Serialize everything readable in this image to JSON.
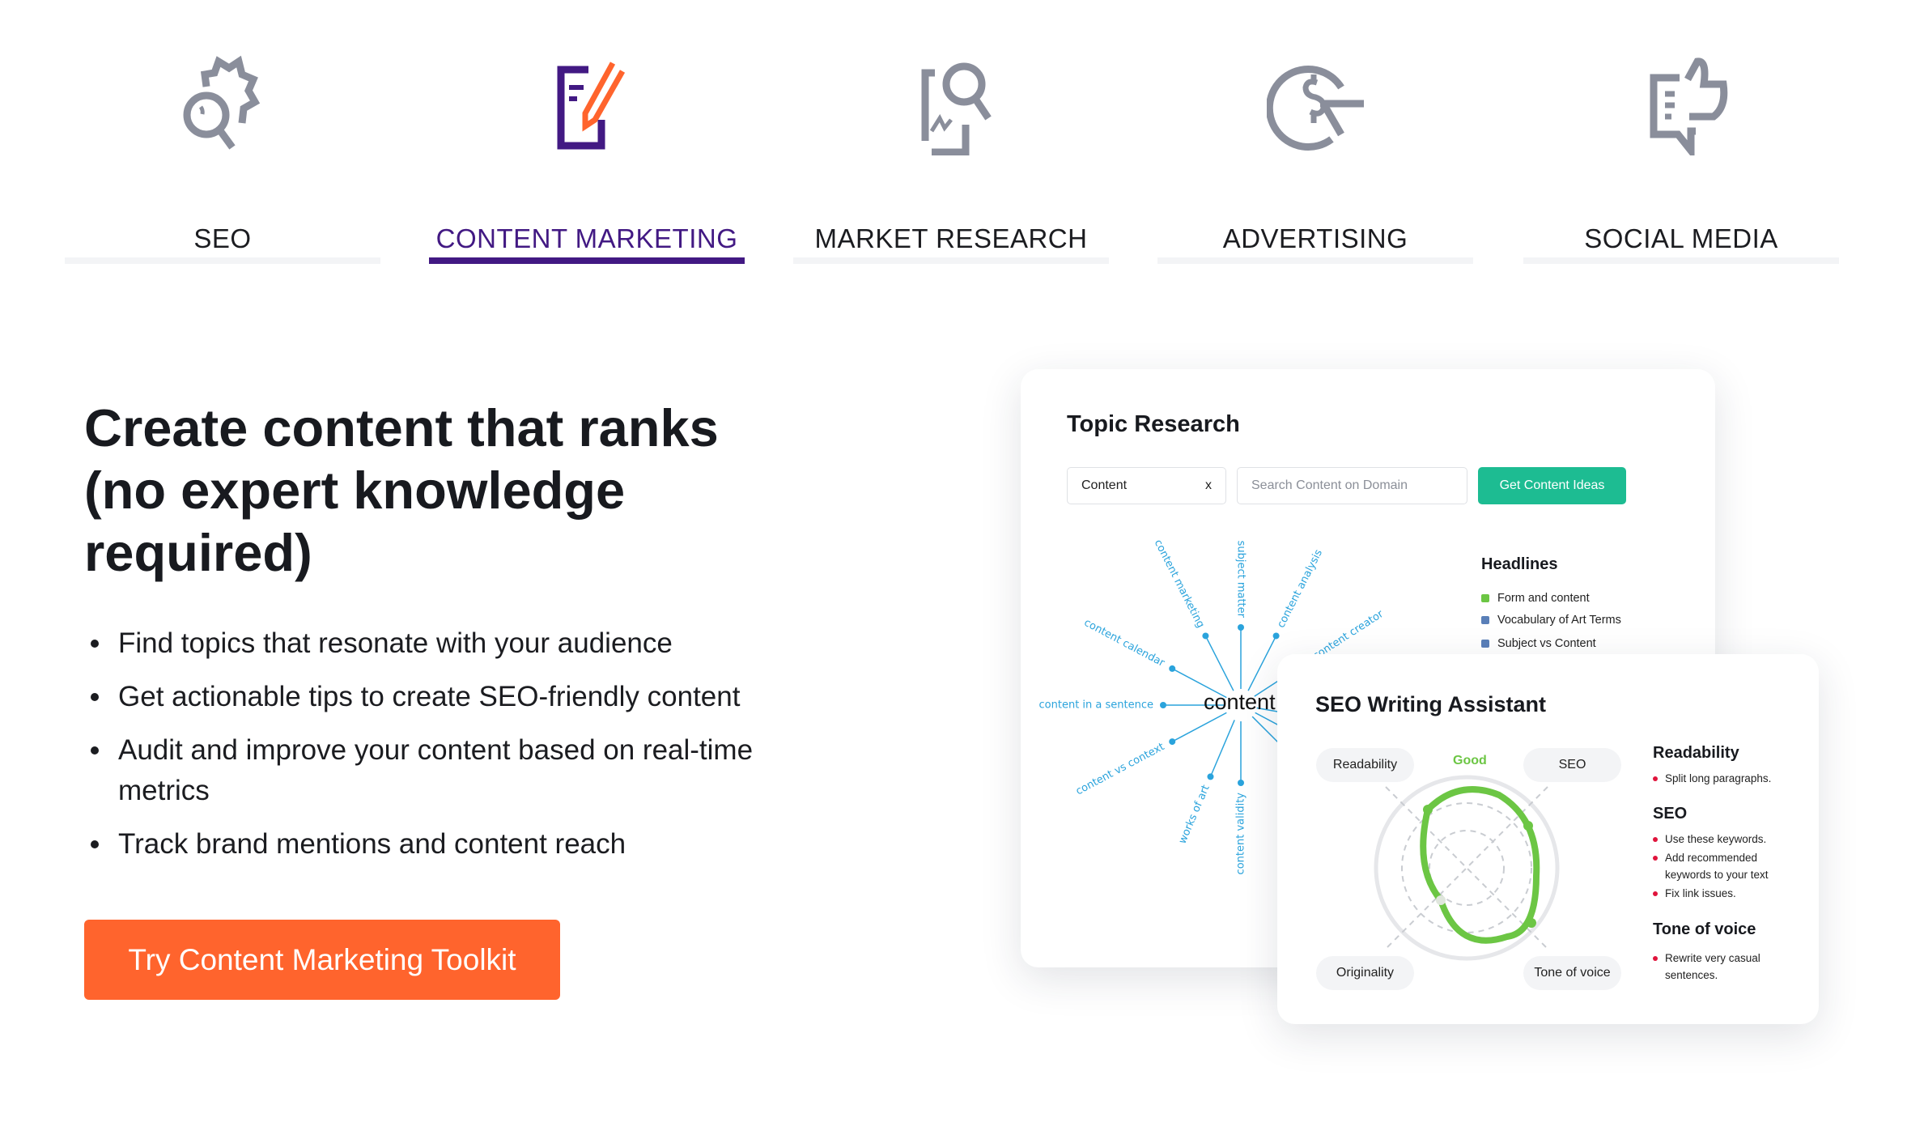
{
  "tabs": [
    {
      "label": "SEO",
      "icon": "gear-magnifier-icon",
      "active": false
    },
    {
      "label": "CONTENT MARKETING",
      "icon": "document-pencil-icon",
      "active": true
    },
    {
      "label": "MARKET RESEARCH",
      "icon": "chart-magnifier-icon",
      "active": false
    },
    {
      "label": "ADVERTISING",
      "icon": "dollar-cursor-icon",
      "active": false
    },
    {
      "label": "SOCIAL MEDIA",
      "icon": "chat-thumbs-up-icon",
      "active": false
    }
  ],
  "hero": {
    "title": "Create content that ranks (no expert knowledge required)",
    "bullets": [
      "Find topics that resonate with your audience",
      "Get actionable tips to create SEO-friendly content",
      "Audit and improve your content based on real-time metrics",
      "Track brand mentions and content reach"
    ],
    "cta": "Try Content Marketing Toolkit"
  },
  "topic_research": {
    "title": "Topic Research",
    "query_value": "Content",
    "clear": "x",
    "domain_placeholder": "Search Content on Domain",
    "button": "Get Content Ideas",
    "center_word": "content",
    "rays": [
      "content marketing",
      "subject matter",
      "content analysis",
      "content creator",
      "content calendar",
      "content in a sentence",
      "content vs context",
      "works of art",
      "content validity"
    ],
    "headlines_title": "Headlines",
    "headlines": [
      "Form and content",
      "Vocabulary of Art Terms",
      "Subject vs Content"
    ]
  },
  "seo_assistant": {
    "title": "SEO Writing Assistant",
    "score": "Good",
    "axes": [
      "Readability",
      "SEO",
      "Originality",
      "Tone of voice"
    ],
    "sections": [
      {
        "title": "Readability",
        "tips": [
          "Split long paragraphs."
        ]
      },
      {
        "title": "SEO",
        "tips": [
          "Use these keywords.",
          "Add recommended keywords to your text",
          "Fix link issues."
        ]
      },
      {
        "title": "Tone of voice",
        "tips": [
          "Rewrite very casual sentences."
        ]
      }
    ]
  },
  "colors": {
    "accent": "#421983",
    "cta": "#ff642d",
    "icon_gray": "#8a8e9b",
    "green_button": "#1dbc92",
    "ray_blue": "#2aa3dc",
    "score_green": "#6cc644",
    "tip_bullet": "#e0143c"
  }
}
